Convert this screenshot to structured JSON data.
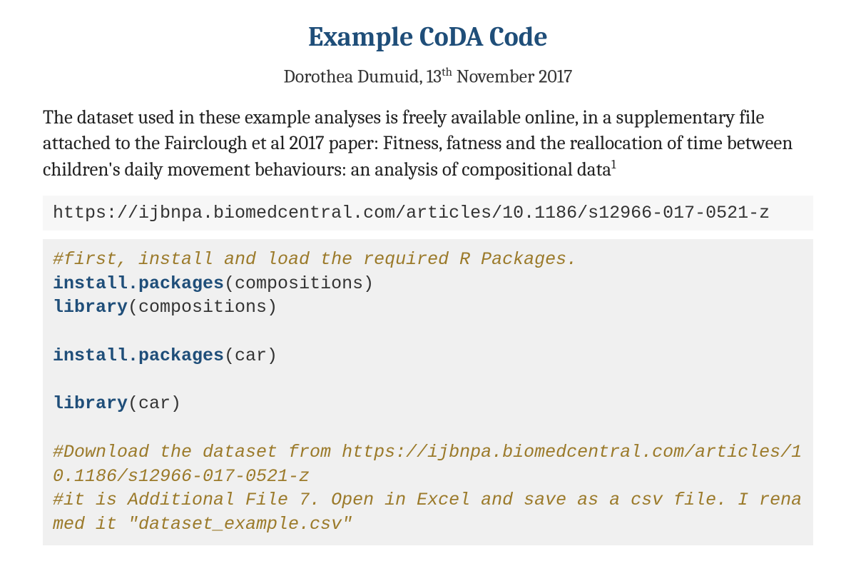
{
  "title": "Example CoDA Code",
  "byline": {
    "author": "Dorothea Dumuid",
    "date_prefix": ", 13",
    "date_suffix": " November 2017",
    "th": "th"
  },
  "intro": {
    "text": "The dataset used in these example analyses is freely available online, in a supplementary file attached to the Fairclough et al 2017 paper: Fitness, fatness and the reallocation of time between children's daily movement behaviours: an analysis of compositional data",
    "footnote": "1"
  },
  "url": "https://ijbnpa.biomedcentral.com/articles/10.1186/s12966-017-0521-z",
  "code": {
    "comment1": "#first, install and load the required R Packages.",
    "kw_install": "install.packages",
    "arg_comp": "(compositions)",
    "kw_library": "library",
    "arg_comp2": "(compositions)",
    "arg_car": "(car)",
    "comment2": "#Download the dataset from https://ijbnpa.biomedcentral.com/articles/10.1186/s12966-017-0521-z",
    "comment3": "#it is Additional File 7. Open in Excel and save as a csv file. I renamed it \"dataset_example.csv\""
  }
}
